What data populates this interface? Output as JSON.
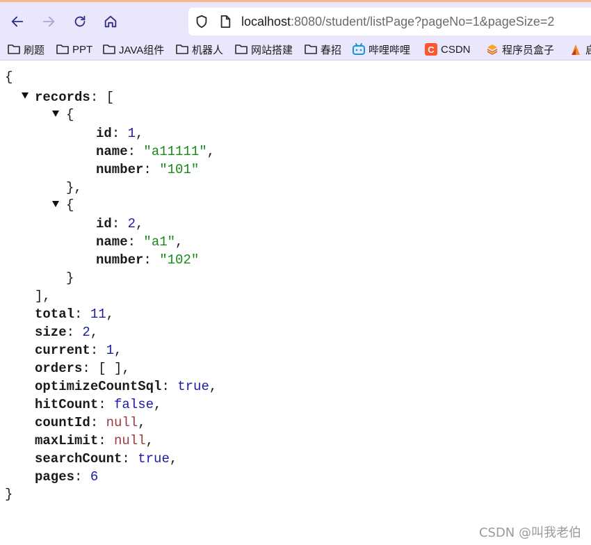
{
  "browser": {
    "url_host": "localhost",
    "url_rest": ":8080/student/listPage?pageNo=1&pageSize=2",
    "bookmarks": [
      {
        "label": "刷题",
        "icon": "folder-icon"
      },
      {
        "label": "PPT",
        "icon": "folder-icon"
      },
      {
        "label": "JAVA组件",
        "icon": "folder-icon"
      },
      {
        "label": "机器人",
        "icon": "folder-icon"
      },
      {
        "label": "网站搭建",
        "icon": "folder-icon"
      },
      {
        "label": "春招",
        "icon": "folder-icon"
      },
      {
        "label": "哔哩哔哩",
        "icon": "bilibili-icon"
      },
      {
        "label": "CSDN",
        "icon": "csdn-icon"
      },
      {
        "label": "程序员盒子",
        "icon": "stack-icon"
      },
      {
        "label": "启",
        "icon": "flame-icon"
      }
    ]
  },
  "json": {
    "open_brace": "{",
    "close_brace": "}",
    "records_key": "records",
    "records_open": "[",
    "records_close": "],",
    "record_open": "{",
    "record_close_1": "},",
    "record_close_2": "}",
    "records": [
      {
        "id": "1",
        "name": "\"a11111\"",
        "number": "\"101\""
      },
      {
        "id": "2",
        "name": "\"a1\"",
        "number": "\"102\""
      }
    ],
    "keys": {
      "id": "id",
      "name": "name",
      "number": "number",
      "total": "total",
      "size": "size",
      "current": "current",
      "orders": "orders",
      "optimizeCountSql": "optimizeCountSql",
      "hitCount": "hitCount",
      "countId": "countId",
      "maxLimit": "maxLimit",
      "searchCount": "searchCount",
      "pages": "pages"
    },
    "values": {
      "total": "11",
      "size": "2",
      "current": "1",
      "orders": "[ ]",
      "optimizeCountSql": "true",
      "hitCount": "false",
      "countId": "null",
      "maxLimit": "null",
      "searchCount": "true",
      "pages": "6"
    }
  },
  "watermark": "CSDN @叫我老伯"
}
